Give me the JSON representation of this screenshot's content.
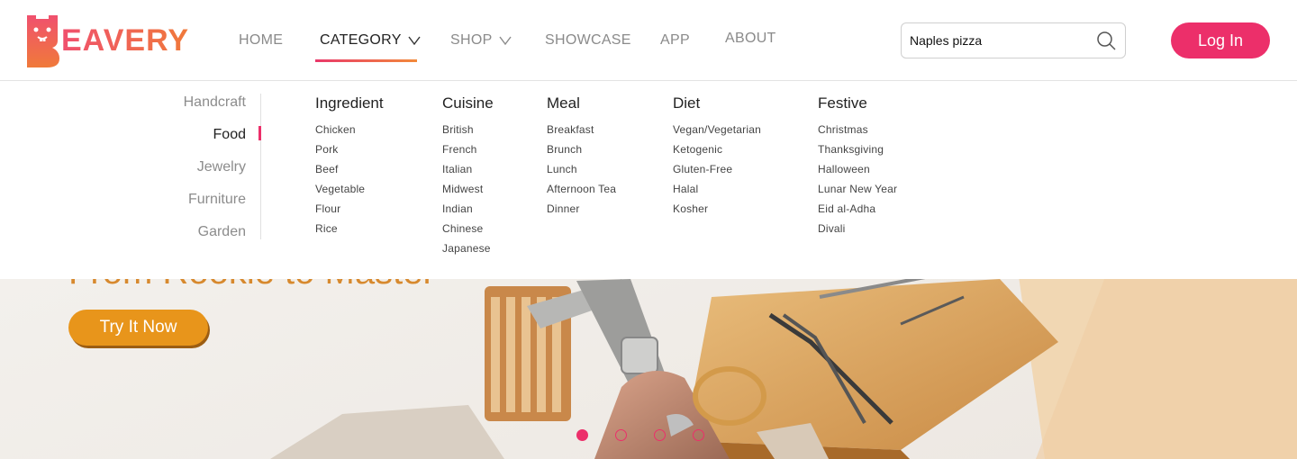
{
  "brand": {
    "name": "EAVERY",
    "logo_icon": "beaver-mascot-icon",
    "colors": {
      "primary": "#ec2f6a",
      "accent": "#f07a3a"
    }
  },
  "nav": {
    "items": [
      {
        "label": "HOME"
      },
      {
        "label": "CATEGORY",
        "has_dropdown": true,
        "active": true
      },
      {
        "label": "SHOP",
        "has_dropdown": true
      },
      {
        "label": "SHOWCASE"
      },
      {
        "label": "APP"
      },
      {
        "label": "ABOUT"
      }
    ]
  },
  "search": {
    "value": "Naples pizza",
    "icon": "search-icon"
  },
  "auth": {
    "login_label": "Log In"
  },
  "mega_menu": {
    "categories": [
      {
        "label": "Handcraft"
      },
      {
        "label": "Food",
        "active": true
      },
      {
        "label": "Jewelry"
      },
      {
        "label": "Furniture"
      },
      {
        "label": "Garden"
      }
    ],
    "columns": [
      {
        "title": "Ingredient",
        "items": [
          "Chicken",
          "Pork",
          "Beef",
          "Vegetable",
          "Flour",
          "Rice"
        ]
      },
      {
        "title": "Cuisine",
        "items": [
          "British",
          "French",
          "Italian",
          "Midwest",
          "Indian",
          "Chinese",
          "Japanese"
        ]
      },
      {
        "title": "Meal",
        "items": [
          "Breakfast",
          "Brunch",
          "Lunch",
          "Afternoon Tea",
          "Dinner"
        ]
      },
      {
        "title": "Diet",
        "items": [
          "Vegan/Vegetarian",
          "Ketogenic",
          "Gluten-Free",
          "Halal",
          "Kosher"
        ]
      },
      {
        "title": "Festive",
        "items": [
          "Christmas",
          "Thanksgiving",
          "Halloween",
          "Lunar New Year",
          "Eid al-Adha",
          "Divali"
        ]
      }
    ]
  },
  "hero": {
    "title": "From Rookie to Master",
    "cta_label": "Try It Now",
    "carousel": {
      "slides": 4,
      "active": 1
    }
  }
}
